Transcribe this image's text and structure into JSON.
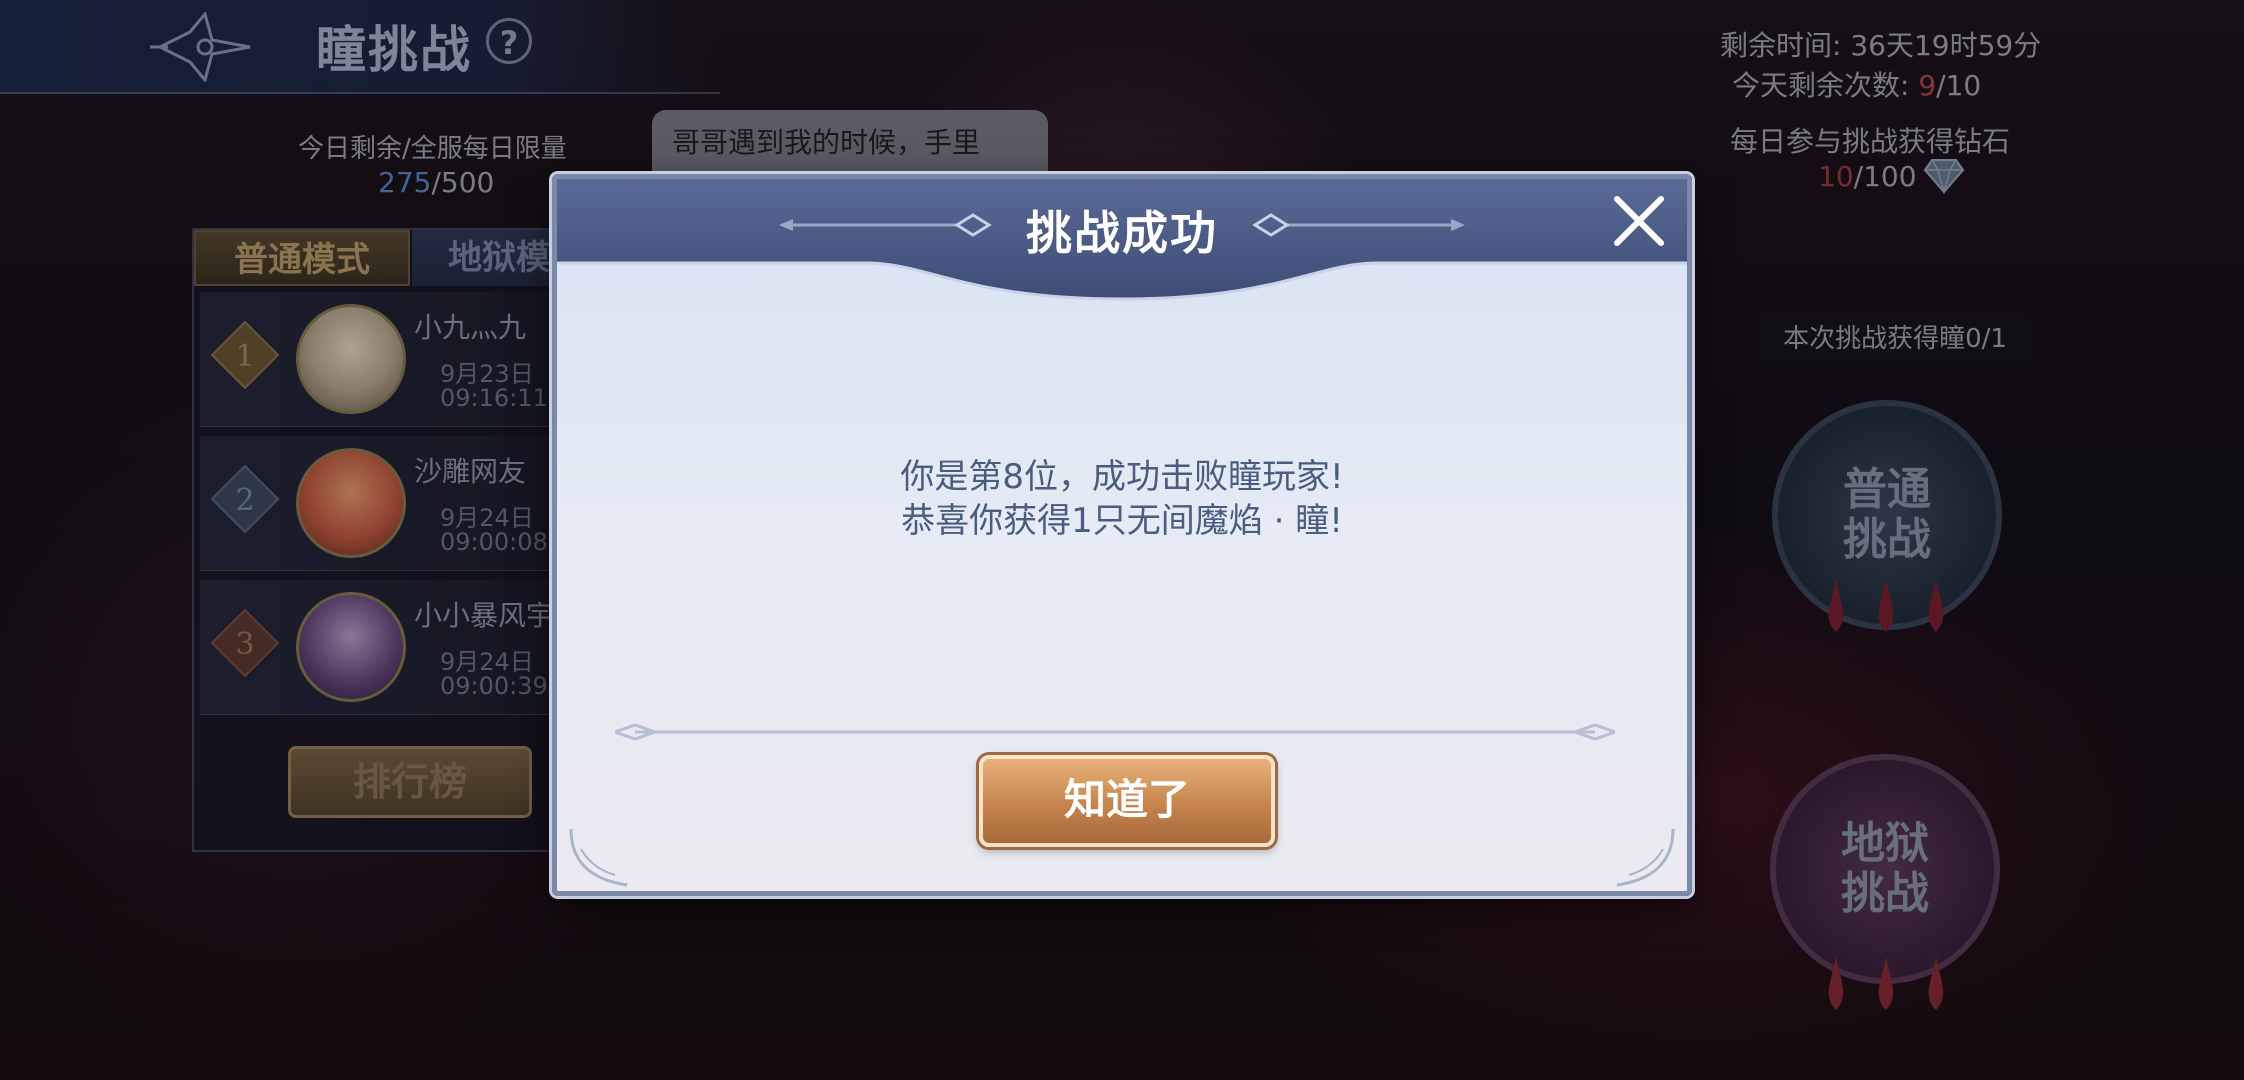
{
  "header": {
    "title": "瞳挑战",
    "help_label": "?"
  },
  "left_info": {
    "limit_label": "今日剩余/全服每日限量",
    "limit_remaining": "275",
    "limit_total": "/500"
  },
  "speech_bubble": {
    "text": "哥哥遇到我的时候，手里"
  },
  "tabs": {
    "normal": "普通模式",
    "hell": "地狱模"
  },
  "ranking": [
    {
      "rank": "1",
      "name": "小九灬九",
      "date": "9月23日",
      "time": "09:16:11"
    },
    {
      "rank": "2",
      "name": "沙雕网友",
      "date": "9月24日",
      "time": "09:00:08"
    },
    {
      "rank": "3",
      "name": "小小暴风宇",
      "date": "9月24日",
      "time": "09:00:39"
    }
  ],
  "rank_button_label": "排行榜",
  "right_info": {
    "remaining_time": "剩余时间: 36天19时59分",
    "remaining_count_label": "今天剩余次数: ",
    "remaining_count_value": "9",
    "remaining_count_total": "/10",
    "diamond_label": "每日参与挑战获得钻石",
    "diamond_value": "10",
    "diamond_total": "/100",
    "gain_label": "本次挑战获得瞳0/1"
  },
  "challenges": {
    "normal_line1": "普通",
    "normal_line2": "挑战",
    "hell_line1": "地狱",
    "hell_line2": "挑战"
  },
  "modal": {
    "title": "挑战成功",
    "message_line1": "你是第8位，成功击败瞳玩家!",
    "message_line2": "恭喜你获得1只无间魔焰 · 瞳!",
    "ok_label": "知道了"
  },
  "colors": {
    "accent_blue": "#5b86c4",
    "warning_red": "#b14848",
    "modal_title_bg": "#4a5a88",
    "button_bronze": "#c5834d"
  }
}
